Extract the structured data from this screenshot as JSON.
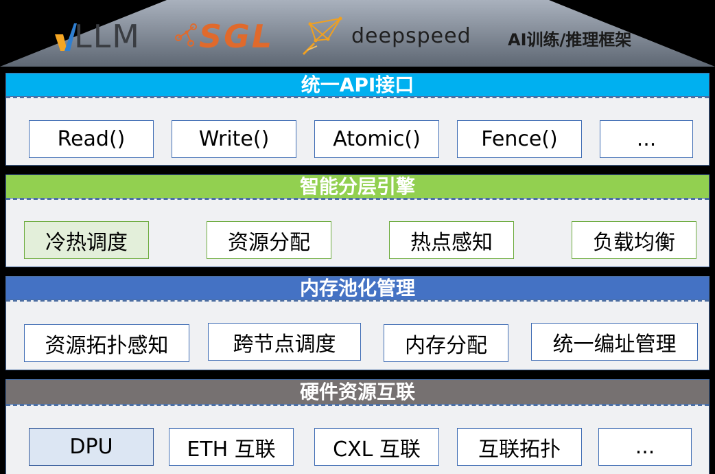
{
  "frameworks": {
    "vllm_logo_text": "LLM",
    "sgl_logo_text": "SGL",
    "deepspeed_logo_text": "deepspeed",
    "caption": "AI训练/推理框架"
  },
  "layers": [
    {
      "title": "统一API接口",
      "header_color": "#00b0f0",
      "items": [
        "Read()",
        "Write()",
        "Atomic()",
        "Fence()",
        "..."
      ]
    },
    {
      "title": "智能分层引擎",
      "header_color": "#92d050",
      "items": [
        "冷热调度",
        "资源分配",
        "热点感知",
        "负载均衡"
      ]
    },
    {
      "title": "内存池化管理",
      "header_color": "#4472c4",
      "items": [
        "资源拓扑感知",
        "跨节点调度",
        "内存分配",
        "统一编址管理"
      ]
    },
    {
      "title": "硬件资源互联",
      "header_color": "#767171",
      "items": [
        "DPU",
        "ETH 互联",
        "CXL 互联",
        "互联拓扑",
        "..."
      ]
    }
  ],
  "colors": {
    "roof_top": "#a9b1bd",
    "roof_bottom": "#5e6773",
    "body_bg": "#f0f1f3",
    "box_border_blue": "#3d6bb3",
    "box_border_green": "#6aaa3a",
    "highlight_green": "#e3efda",
    "highlight_blue": "#dce6f3"
  }
}
